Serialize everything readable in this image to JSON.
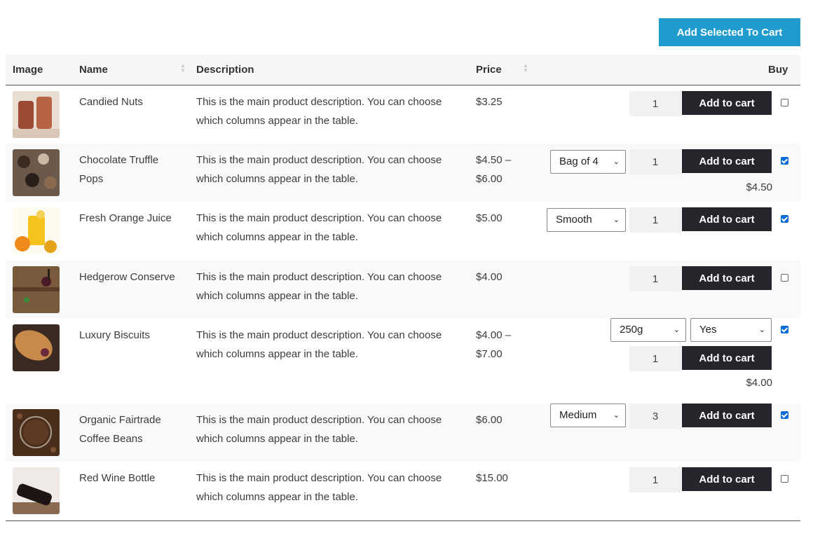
{
  "toolbar": {
    "add_selected_label": "Add Selected To Cart"
  },
  "headers": {
    "image": "Image",
    "name": "Name",
    "description": "Description",
    "price": "Price",
    "buy": "Buy"
  },
  "products": [
    {
      "name": "Candied Nuts",
      "description": "This is the main product description. You can choose which columns appear in the table.",
      "price": "$3.25",
      "qty": "1",
      "button": "Add to cart",
      "checked": false,
      "options": [],
      "variation_price": "",
      "thumb_colors": [
        "#c9b7a4",
        "#8b3a2a"
      ]
    },
    {
      "name": "Chocolate Truffle Pops",
      "description": "This is the main product description. You can choose which columns appear in the table.",
      "price": "$4.50 – $6.00",
      "qty": "1",
      "button": "Add to cart",
      "checked": true,
      "options": [
        "Bag of 4"
      ],
      "variation_price": "$4.50",
      "thumb_colors": [
        "#5a4a3e",
        "#b8a896"
      ]
    },
    {
      "name": "Fresh Orange Juice",
      "description": "This is the main product description. You can choose which columns appear in the table.",
      "price": "$5.00",
      "qty": "1",
      "button": "Add to cart",
      "checked": true,
      "options": [
        "Smooth"
      ],
      "variation_price": "",
      "thumb_colors": [
        "#f5c52a",
        "#ffffff"
      ]
    },
    {
      "name": "Hedgerow Conserve",
      "description": "This is the main product description. You can choose which columns appear in the table.",
      "price": "$4.00",
      "qty": "1",
      "button": "Add to cart",
      "checked": false,
      "options": [],
      "variation_price": "",
      "thumb_colors": [
        "#6b4a30",
        "#3c2a1e"
      ]
    },
    {
      "name": "Luxury Biscuits",
      "description": "This is the main product description. You can choose which columns appear in the table.",
      "price": "$4.00 – $7.00",
      "qty": "1",
      "button": "Add to cart",
      "checked": true,
      "options": [
        "250g",
        "Yes"
      ],
      "variation_price": "$4.00",
      "thumb_colors": [
        "#c48a4a",
        "#3a2a20"
      ]
    },
    {
      "name": "Organic Fairtrade Coffee Beans",
      "description": "This is the main product description. You can choose which columns appear in the table.",
      "price": "$6.00",
      "qty": "3",
      "button": "Add to cart",
      "checked": true,
      "options": [
        "Medium"
      ],
      "variation_price": "",
      "thumb_colors": [
        "#4a3020",
        "#8a6040"
      ]
    },
    {
      "name": "Red Wine Bottle",
      "description": "This is the main product description. You can choose which columns appear in the table.",
      "price": "$15.00",
      "qty": "1",
      "button": "Add to cart",
      "checked": false,
      "options": [],
      "variation_price": "",
      "thumb_colors": [
        "#e8e4e2",
        "#2a1a1a"
      ]
    }
  ]
}
